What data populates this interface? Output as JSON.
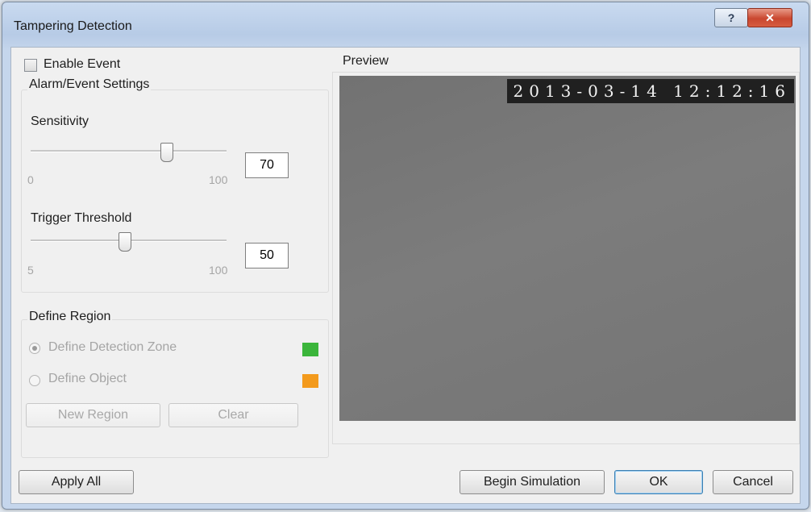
{
  "window": {
    "title": "Tampering Detection",
    "help_glyph": "?",
    "close_glyph": "✕"
  },
  "enable_event": {
    "label": "Enable Event",
    "checked": false
  },
  "alarm_settings": {
    "group_label": "Alarm/Event Settings",
    "sensitivity": {
      "label": "Sensitivity",
      "min": "0",
      "max": "100",
      "value": "70",
      "fraction": 0.7
    },
    "trigger_threshold": {
      "label": "Trigger Threshold",
      "min": "5",
      "max": "100",
      "value": "50",
      "fraction": 0.5
    }
  },
  "define_region": {
    "group_label": "Define Region",
    "options": [
      {
        "label": "Define Detection Zone",
        "selected": true,
        "color": "#3bb53b"
      },
      {
        "label": "Define Object",
        "selected": false,
        "color": "#f39a1c"
      }
    ],
    "new_region_label": "New Region",
    "clear_label": "Clear"
  },
  "preview": {
    "label": "Preview",
    "timestamp": "2013-03-14  12:12:16"
  },
  "footer": {
    "apply_all_label": "Apply All",
    "begin_simulation_label": "Begin Simulation",
    "ok_label": "OK",
    "cancel_label": "Cancel"
  }
}
